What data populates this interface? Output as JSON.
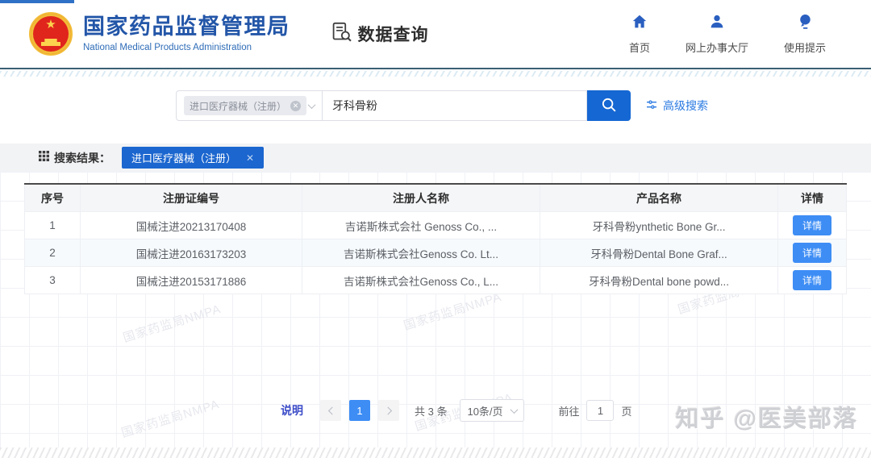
{
  "header": {
    "brand_title": "国家药品监督管理局",
    "brand_subtitle": "National Medical Products Administration",
    "app_title": "数据查询",
    "nav": [
      {
        "label": "首页"
      },
      {
        "label": "网上办事大厅"
      },
      {
        "label": "使用提示"
      }
    ]
  },
  "search": {
    "category_tag": "进口医疗器械（注册）",
    "query_value": "牙科骨粉",
    "advanced_label": "高级搜索"
  },
  "results_bar": {
    "label": "搜索结果：",
    "filter_tag": "进口医疗器械（注册）"
  },
  "table": {
    "columns": {
      "no": "序号",
      "cert": "注册证编号",
      "registrant": "注册人名称",
      "product": "产品名称",
      "detail": "详情"
    },
    "detail_button": "详情",
    "rows": [
      {
        "no": "1",
        "cert": "国械注进20213170408",
        "registrant": "吉诺斯株式会社 Genoss Co., ...",
        "product": "牙科骨粉ynthetic Bone Gr..."
      },
      {
        "no": "2",
        "cert": "国械注进20163173203",
        "registrant": "吉诺斯株式会社Genoss Co. Lt...",
        "product": "牙科骨粉Dental Bone Graf..."
      },
      {
        "no": "3",
        "cert": "国械注进20153171886",
        "registrant": "吉诺斯株式会社Genoss Co., L...",
        "product": "牙科骨粉Dental bone powd..."
      }
    ]
  },
  "pagination": {
    "note": "说明",
    "page": "1",
    "total": "共 3 条",
    "page_size": "10条/页",
    "goto_label": "前往",
    "goto_value": "1",
    "goto_unit": "页"
  },
  "watermarks": {
    "pattern_text": "国家药监局NMPA",
    "site_credit": "知乎 @医美部落"
  },
  "colors": {
    "brand_blue": "#2356a8",
    "primary_blue": "#1567d3",
    "filter_tag_blue": "#1b66cf",
    "detail_button_blue": "#3d8df5",
    "link_blue": "#2a7ae2",
    "note_link": "#3c4cc8"
  }
}
